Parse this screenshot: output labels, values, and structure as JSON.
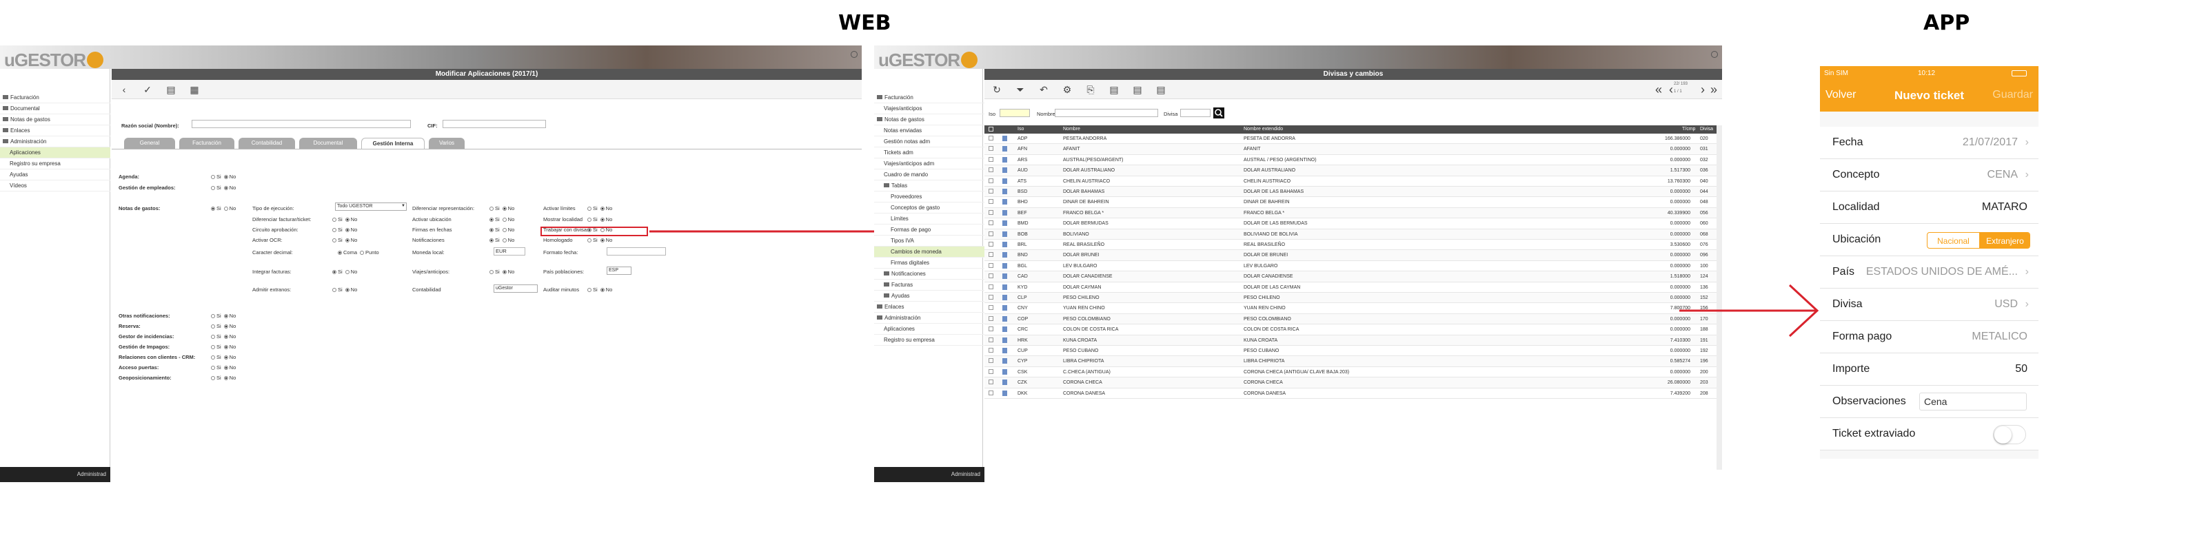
{
  "labels": {
    "web": "WEB",
    "app": "APP"
  },
  "colors": {
    "accent": "#f7a21a",
    "arrow": "#d9232d",
    "selected": "#e6f2c8"
  },
  "logo": {
    "prefix": "u",
    "text": "GESTOR"
  },
  "footer_user": "Administrad",
  "win1": {
    "title": "Modificar Aplicaciones (2017/1)",
    "sidebar": [
      {
        "label": "Facturación",
        "type": "folder"
      },
      {
        "label": "Documental",
        "type": "folder"
      },
      {
        "label": "Notas de gastos",
        "type": "folder"
      },
      {
        "label": "Enlaces",
        "type": "folder"
      },
      {
        "label": "Administración",
        "type": "folder"
      },
      {
        "label": "Aplicaciones",
        "type": "sub",
        "selected": true
      },
      {
        "label": "Registro su empresa",
        "type": "sub"
      },
      {
        "label": "Ayudas",
        "type": "sub"
      },
      {
        "label": "Vídeos",
        "type": "sub"
      }
    ],
    "toolbar_icons": [
      "chevron-left-icon",
      "check-icon",
      "document-icon",
      "calendar-icon"
    ],
    "razon_label": "Razón social (Nombre):",
    "cif_label": "CIF:",
    "tabs": [
      "General",
      "Facturación",
      "Contabilidad",
      "Documental",
      "Gestión Interna",
      "Varios"
    ],
    "active_tab": 4,
    "agenda": "Agenda:",
    "gestion_empleados": "Gestión de empleados:",
    "notas_gastos": "Notas de gastos:",
    "si": "Si",
    "no": "No",
    "tipo_ejecucion": "Tipo de ejecución:",
    "tipo_ejecucion_value": "Todo UGESTOR",
    "col2": [
      {
        "label": "Diferenciar facturar/ticket:"
      },
      {
        "label": "Circuito aprobación:"
      },
      {
        "label": "Activar OCR:"
      },
      {
        "label": "Caracter decimal:"
      },
      {
        "label": "Integrar facturas:"
      },
      {
        "label": "Admitir extranos:"
      }
    ],
    "coma": "Coma",
    "punto": "Punto",
    "col3": [
      {
        "label": "Diferenciar representación:"
      },
      {
        "label": "Activar ubicación"
      },
      {
        "label": "Firmas en fechas"
      },
      {
        "label": "Notificaciones"
      },
      {
        "label": "Moneda local:"
      },
      {
        "label": "Viajes/anticipos:"
      },
      {
        "label": "Contabilidad"
      }
    ],
    "moneda_value": "EUR",
    "contabilidad_value": "uGestor",
    "col4": [
      {
        "label": "Activar límites"
      },
      {
        "label": "Mostrar localidad"
      },
      {
        "label": "Trabajar con divisas"
      },
      {
        "label": "Homologado"
      },
      {
        "label": "Formato fecha:"
      },
      {
        "label": "País poblaciones:"
      },
      {
        "label": "Auditar minutos"
      }
    ],
    "pais_value": "ESP",
    "lower": [
      "Otras notificaciones:",
      "Reserva:",
      "Gestor de incidencias:",
      "Gestión de Impagos:",
      "Relaciones con clientes - CRM:",
      "Acceso puertas:",
      "Geoposicionamiento:"
    ]
  },
  "win2": {
    "title": "Divisas y cambios",
    "sidebar": [
      {
        "label": "Facturación",
        "type": "folder"
      },
      {
        "label": "Viajes/anticipos",
        "type": "sub"
      },
      {
        "label": "Notas de gastos",
        "type": "folder"
      },
      {
        "label": "Notas enviadas",
        "type": "sub"
      },
      {
        "label": "Gestión notas adm",
        "type": "sub"
      },
      {
        "label": "Tickets adm",
        "type": "sub"
      },
      {
        "label": "Viajes/anticipos adm",
        "type": "sub"
      },
      {
        "label": "Cuadro de mando",
        "type": "sub"
      },
      {
        "label": "Tablas",
        "type": "folder2"
      },
      {
        "label": "Proveedores",
        "type": "sub2"
      },
      {
        "label": "Conceptos de gasto",
        "type": "sub2"
      },
      {
        "label": "Límites",
        "type": "sub2"
      },
      {
        "label": "Formas de pago",
        "type": "sub2"
      },
      {
        "label": "Tipos IVA",
        "type": "sub2"
      },
      {
        "label": "Cambios de moneda",
        "type": "sub2",
        "selected": true
      },
      {
        "label": "Firmas digitales",
        "type": "sub2"
      },
      {
        "label": "Notificaciones",
        "type": "folder2"
      },
      {
        "label": "Facturas",
        "type": "folder2"
      },
      {
        "label": "Ayudas",
        "type": "folder2"
      },
      {
        "label": "Enlaces",
        "type": "folder"
      },
      {
        "label": "Administración",
        "type": "folder"
      },
      {
        "label": "Aplicaciones",
        "type": "sub"
      },
      {
        "label": "Registro su empresa",
        "type": "sub"
      }
    ],
    "toolbar_icons": [
      "refresh-icon",
      "filter-icon",
      "undo-icon",
      "settings-icon",
      "attach-icon",
      "document-icon",
      "document-icon",
      "document-icon"
    ],
    "pager": {
      "count": "22/ 193",
      "page": "1 / 1",
      "first": "«",
      "prev": "‹",
      "next": "›",
      "last": "»"
    },
    "filter": {
      "iso": "Iso",
      "nombre": "Nombre",
      "divisa": "Divisa"
    },
    "columns": [
      "Iso",
      "Nombre",
      "Nombre extendido",
      "T/cmp",
      "Divisa"
    ],
    "rows": [
      [
        "ADP",
        "PESETA ANDORRA",
        "PESETA DE ANDORRA",
        "166.386000",
        "020"
      ],
      [
        "AFN",
        "AFANIT",
        "AFANIT",
        "0.000000",
        "031"
      ],
      [
        "ARS",
        "AUSTRAL(PESO/ARGENT)",
        "AUSTRAL / PESO (ARGENTINO)",
        "0.000000",
        "032"
      ],
      [
        "AUD",
        "DOLAR AUSTRALIANO",
        "DOLAR AUSTRALIANO",
        "1.517300",
        "036"
      ],
      [
        "ATS",
        "CHELIN AUSTRIACO",
        "CHELIN AUSTRIACO",
        "13.760300",
        "040"
      ],
      [
        "BSD",
        "DOLAR BAHAMAS",
        "DOLAR DE LAS BAHAMAS",
        "0.000000",
        "044"
      ],
      [
        "BHD",
        "DINAR DE BAHREIN",
        "DINAR DE BAHREIN",
        "0.000000",
        "048"
      ],
      [
        "BEF",
        "FRANCO BELGA *",
        "FRANCO BELGA *",
        "40.339900",
        "056"
      ],
      [
        "BMD",
        "DOLAR BERMUDAS",
        "DOLAR DE LAS BERMUDAS",
        "0.000000",
        "060"
      ],
      [
        "BOB",
        "BOLIVIANO",
        "BOLIVIANO DE BOLIVIA",
        "0.000000",
        "068"
      ],
      [
        "BRL",
        "REAL BRASILEÑO",
        "REAL BRASILEÑO",
        "3.530600",
        "076"
      ],
      [
        "BND",
        "DOLAR BRUNEI",
        "DOLAR DE BRUNEI",
        "0.000000",
        "096"
      ],
      [
        "BGL",
        "LEV BULGARO",
        "LEV BULGARO",
        "0.000000",
        "100"
      ],
      [
        "CAD",
        "DOLAR CANADIENSE",
        "DOLAR CANADIENSE",
        "1.518000",
        "124"
      ],
      [
        "KYD",
        "DOLAR CAYMAN",
        "DOLAR DE LAS CAYMAN",
        "0.000000",
        "136"
      ],
      [
        "CLP",
        "PESO CHILENO",
        "PESO CHILENO",
        "0.000000",
        "152"
      ],
      [
        "CNY",
        "YUAN REN CHINO",
        "YUAN REN CHINO",
        "7.800700",
        "156"
      ],
      [
        "COP",
        "PESO COLOMBIANO",
        "PESO COLOMBIANO",
        "0.000000",
        "170"
      ],
      [
        "CRC",
        "COLON DE COSTA RICA",
        "COLON DE COSTA RICA",
        "0.000000",
        "188"
      ],
      [
        "HRK",
        "KUNA CROATA",
        "KUNA CROATA",
        "7.410300",
        "191"
      ],
      [
        "CUP",
        "PESO CUBANO",
        "PESO CUBANO",
        "0.000000",
        "192"
      ],
      [
        "CYP",
        "LIBRA CHIPRIOTA",
        "LIBRA CHIPRIOTA",
        "0.585274",
        "196"
      ],
      [
        "CSK",
        "C.CHECA (ANTIGUA)",
        "CORONA CHECA (ANTIGUA/ CLAVE BAJA 203)",
        "0.000000",
        "200"
      ],
      [
        "CZK",
        "CORONA CHECA",
        "CORONA CHECA",
        "26.080000",
        "203"
      ],
      [
        "DKK",
        "CORONA DANESA",
        "CORONA DANESA",
        "7.439200",
        "208"
      ]
    ]
  },
  "app": {
    "status": {
      "carrier": "Sin SIM",
      "time": "10:12"
    },
    "nav": {
      "back": "Volver",
      "title": "Nuevo ticket",
      "save": "Guardar"
    },
    "fields": [
      {
        "label": "Fecha",
        "value": "21/07/2017",
        "chevron": true
      },
      {
        "label": "Concepto",
        "value": "CENA",
        "chevron": true
      },
      {
        "label": "Localidad",
        "value": "MATARO",
        "chevron": false
      },
      {
        "label": "Ubicación",
        "segmented": [
          "Nacional",
          "Extranjero"
        ],
        "selected": 1
      },
      {
        "label": "País",
        "value": "ESTADOS UNIDOS DE AMÉ...",
        "chevron": true
      },
      {
        "label": "Divisa",
        "value": "USD",
        "chevron": true
      },
      {
        "label": "Forma pago",
        "value": "METALICO",
        "chevron": false
      },
      {
        "label": "Importe",
        "value": "50",
        "chevron": false
      },
      {
        "label": "Observaciones",
        "input": "Cena"
      },
      {
        "label": "Ticket extraviado",
        "toggle": false
      }
    ]
  }
}
